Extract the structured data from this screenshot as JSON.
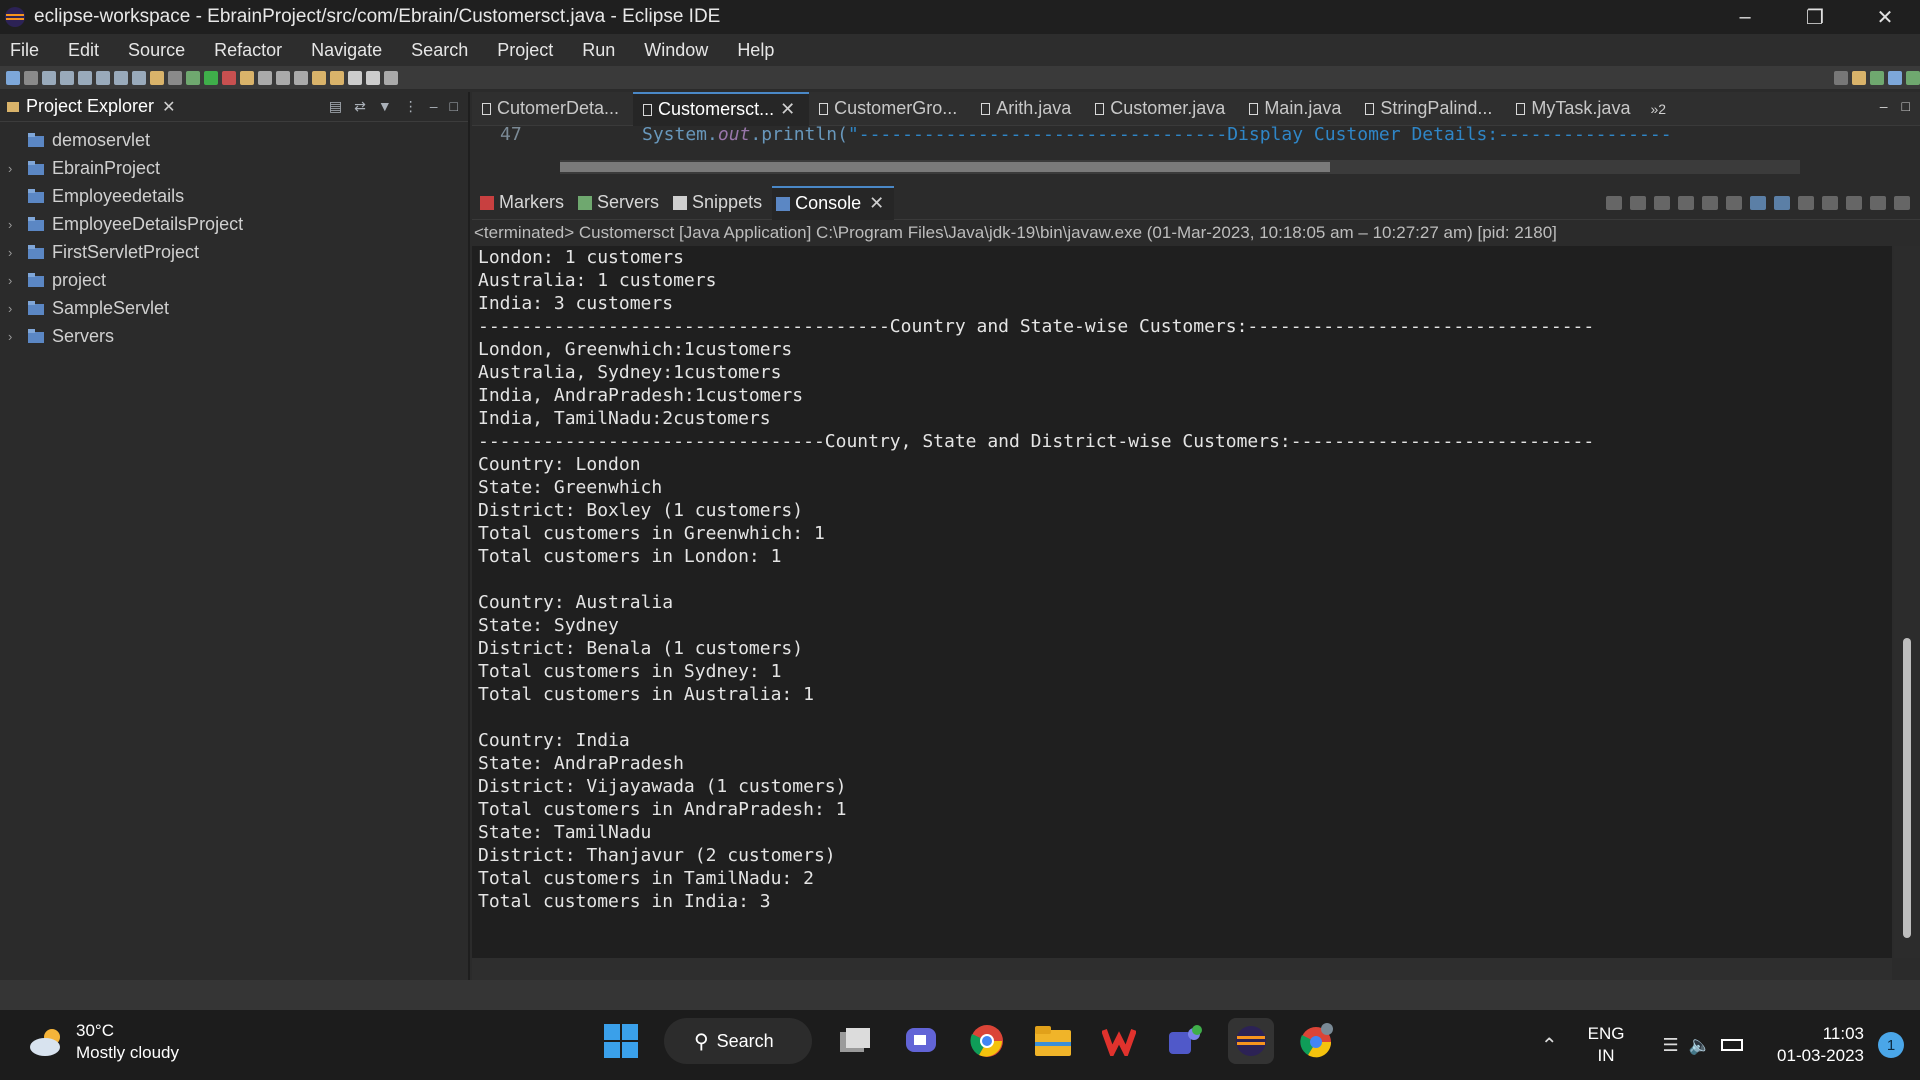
{
  "window": {
    "title": "eclipse-workspace - EbrainProject/src/com/Ebrain/Customersct.java - Eclipse IDE"
  },
  "menu": [
    "File",
    "Edit",
    "Source",
    "Refactor",
    "Navigate",
    "Search",
    "Project",
    "Run",
    "Window",
    "Help"
  ],
  "explorer": {
    "title": "Project Explorer",
    "items": [
      {
        "label": "demoservlet",
        "expandable": false
      },
      {
        "label": "EbrainProject",
        "expandable": true
      },
      {
        "label": "Employeedetails",
        "expandable": false
      },
      {
        "label": "EmployeeDetailsProject",
        "expandable": true
      },
      {
        "label": "FirstServletProject",
        "expandable": true
      },
      {
        "label": "project",
        "expandable": true
      },
      {
        "label": "SampleServlet",
        "expandable": true
      },
      {
        "label": "Servers",
        "expandable": true
      }
    ]
  },
  "editor": {
    "tabs": [
      {
        "label": "CutomerDeta..."
      },
      {
        "label": "Customersct...",
        "active": true
      },
      {
        "label": "CustomerGro..."
      },
      {
        "label": "Arith.java"
      },
      {
        "label": "Customer.java"
      },
      {
        "label": "Main.java"
      },
      {
        "label": "StringPalind..."
      },
      {
        "label": "MyTask.java"
      }
    ],
    "overflow": "»2",
    "line_number": "47",
    "code_prefix": "System.",
    "code_field": "out",
    "code_method": ".println(",
    "code_string": "\"----------------------------------Display Customer Details:----------------"
  },
  "console": {
    "tabs": [
      {
        "label": "Markers"
      },
      {
        "label": "Servers"
      },
      {
        "label": "Snippets"
      },
      {
        "label": "Console",
        "active": true
      }
    ],
    "status": "<terminated> Customersct [Java Application] C:\\Program Files\\Java\\jdk-19\\bin\\javaw.exe  (01-Mar-2023, 10:18:05 am – 10:27:27 am) [pid: 2180]",
    "lines": [
      "London: 1 customers",
      "Australia: 1 customers",
      "India: 3 customers",
      "--------------------------------------Country and State-wise Customers:--------------------------------",
      "London, Greenwhich:1customers",
      "Australia, Sydney:1customers",
      "India, AndraPradesh:1customers",
      "India, TamilNadu:2customers",
      "--------------------------------Country, State and District-wise Customers:----------------------------",
      "Country: London",
      "State: Greenwhich",
      "District: Boxley (1 customers)",
      "Total customers in Greenwhich: 1",
      "Total customers in London: 1",
      "",
      "Country: Australia",
      "State: Sydney",
      "District: Benala (1 customers)",
      "Total customers in Sydney: 1",
      "Total customers in Australia: 1",
      "",
      "Country: India",
      "State: AndraPradesh",
      "District: Vijayawada (1 customers)",
      "Total customers in AndraPradesh: 1",
      "State: TamilNadu",
      "District: Thanjavur (2 customers)",
      "Total customers in TamilNadu: 2",
      "Total customers in India: 3"
    ]
  },
  "taskbar": {
    "weather_temp": "30°C",
    "weather_desc": "Mostly cloudy",
    "search_label": "Search",
    "lang_top": "ENG",
    "lang_bottom": "IN",
    "time": "11:03",
    "date": "01-03-2023",
    "notifications": "1"
  },
  "colors": {
    "accent": "#4a88c7",
    "console_bg": "#1f1f1f",
    "taskbar_bg": "#1c1c1c"
  }
}
